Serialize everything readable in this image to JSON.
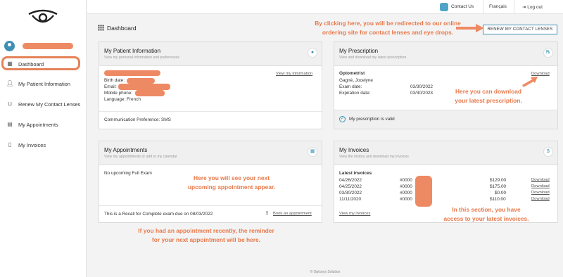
{
  "topbar": {
    "contact": "Contact Us",
    "language": "Français",
    "logout": "Log out"
  },
  "sidebar": {
    "items": [
      {
        "label": "Dashboard",
        "icon": "grid-icon"
      },
      {
        "label": "My Patient Information",
        "icon": "user-icon"
      },
      {
        "label": "Renew My Contact Lenses",
        "icon": "basket-icon"
      },
      {
        "label": "My Appointments",
        "icon": "calendar-icon"
      },
      {
        "label": "My Invoices",
        "icon": "document-icon"
      }
    ]
  },
  "page": {
    "title": "Dashboard",
    "renew_button": "RENEW MY CONTACT LENSES"
  },
  "patient": {
    "title": "My Patient Information",
    "subtitle": "View my personal information and preferences",
    "view_link": "View my information",
    "birth": "Birth date:",
    "email": "Email:",
    "mobile": "Mobile phone:",
    "language": "Language: French",
    "comm": "Communication Preference: SMS"
  },
  "prescription": {
    "title": "My Prescription",
    "subtitle": "View and download my latest prescription",
    "role": "Optometrist",
    "doctor": "Gagné, Jocelyne",
    "exam_label": "Exam date:",
    "exam_date": "03/30/2022",
    "exp_label": "Expiration date:",
    "exp_date": "03/30/2023",
    "download": "Download",
    "valid": "My prescription is valid"
  },
  "appointments": {
    "title": "My Appointments",
    "subtitle": "View my appointments or add to my calendar",
    "none": "No upcoming Full Exam",
    "recall": "This is a Recall for Complete exam due on 08/03/2022",
    "book": "Book an appointment"
  },
  "invoices": {
    "title": "My Invoices",
    "subtitle": "View the history and download my invoices",
    "latest": "Latest invoices",
    "rows": [
      {
        "date": "04/26/2022",
        "num": "#0000",
        "amount": "$129.00",
        "link": "Download"
      },
      {
        "date": "04/25/2022",
        "num": "#0000",
        "amount": "$175.00",
        "link": "Download"
      },
      {
        "date": "03/30/2022",
        "num": "#0000",
        "amount": "$0.00",
        "link": "Download"
      },
      {
        "date": "11/11/2020",
        "num": "#0000",
        "amount": "$110.00",
        "link": "Download"
      }
    ],
    "view_link": "View my invoices"
  },
  "annotations": {
    "renew_1": "By clicking here, you will be redirected to our online",
    "renew_2": "ordering site for contact lenses and eye drops.",
    "download_1": "Here you can download",
    "download_2": "your latest prescription.",
    "appt_1": "Here you will see your next",
    "appt_2": "upcoming appointment appear.",
    "invoice_1": "In this section, you have",
    "invoice_2": "access to your latest invoices.",
    "reminder_1": "If you had an appointment recently, the reminder",
    "reminder_2": "for your next appointment will be here."
  },
  "footer": "© Optosys Solution",
  "colors": {
    "accent": "#3d8fb5",
    "annotation": "#e8784a",
    "redaction": "#ee8a63"
  }
}
